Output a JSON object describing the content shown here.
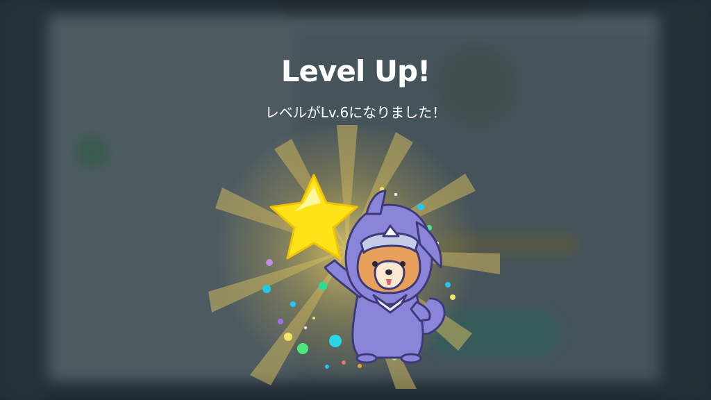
{
  "modal": {
    "title": "Level Up!",
    "message": "レベルがLv.6になりました！"
  },
  "illustration": {
    "character": "ninja-dog",
    "icon": "star-icon"
  },
  "colors": {
    "overlay": "#2a3138",
    "star": "#ffe319",
    "ninja_suit": "#8a85d9",
    "dog_face": "#e8a15a",
    "rays": "#d8c060"
  }
}
